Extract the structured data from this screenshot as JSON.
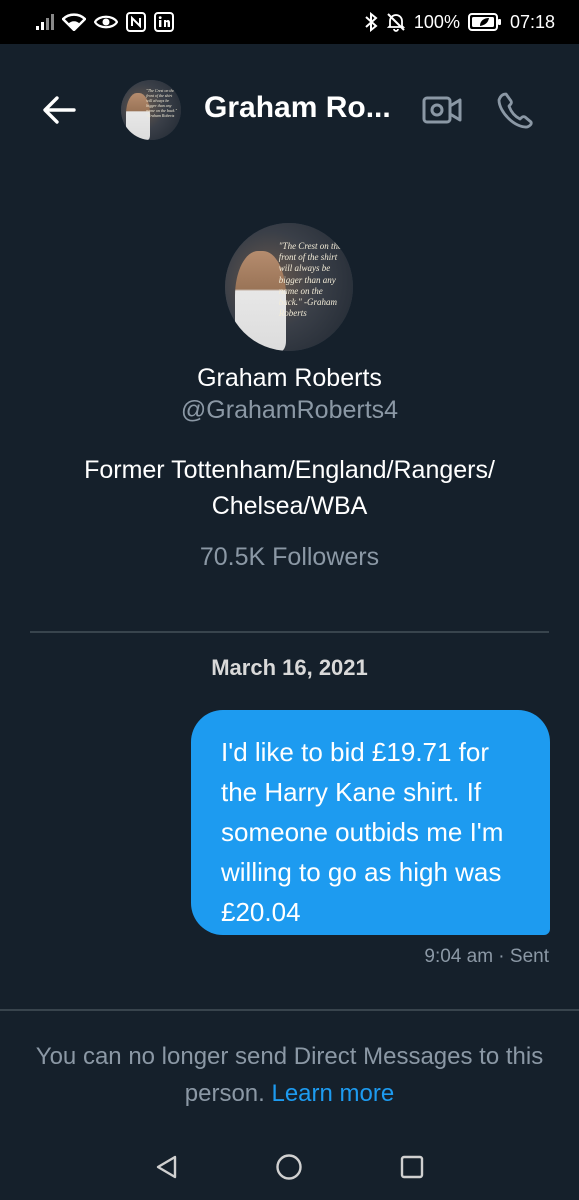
{
  "status_bar": {
    "left_icons": [
      "signal-icon",
      "wifi-icon",
      "eye-icon",
      "nfc-icon",
      "linkedin-icon"
    ],
    "right_icons": [
      "bluetooth-icon",
      "mute-icon"
    ],
    "battery": "100%",
    "time": "07:18"
  },
  "header": {
    "title": "Graham Ro...",
    "back_icon": "arrow-left-icon",
    "video_icon": "video-call-icon",
    "call_icon": "phone-icon"
  },
  "profile": {
    "avatar_quote": "\"The Crest on the front of the shirt will always be bigger than any name on the back.\" -Graham Roberts",
    "name": "Graham Roberts",
    "handle": "@GrahamRoberts4",
    "bio": "Former Tottenham/England/Rangers/\nChelsea/WBA",
    "followers": "70.5K Followers"
  },
  "conversation": {
    "date": "March 16, 2021",
    "messages": [
      {
        "text": "I'd like to bid £19.71 for\nthe Harry Kane shirt. If\nsomeone outbids me I'm\nwilling to go as high was\n£20.04",
        "meta": "9:04 am · Sent"
      }
    ]
  },
  "notice": {
    "text": "You can no longer send Direct Messages to this person. ",
    "link": "Learn more"
  },
  "nav": {
    "icons": [
      "nav-back-icon",
      "nav-home-icon",
      "nav-recents-icon"
    ]
  },
  "colors": {
    "background": "#15202b",
    "accent": "#1d9bf0",
    "muted_text": "#8b98a5",
    "divider": "#38444d"
  }
}
